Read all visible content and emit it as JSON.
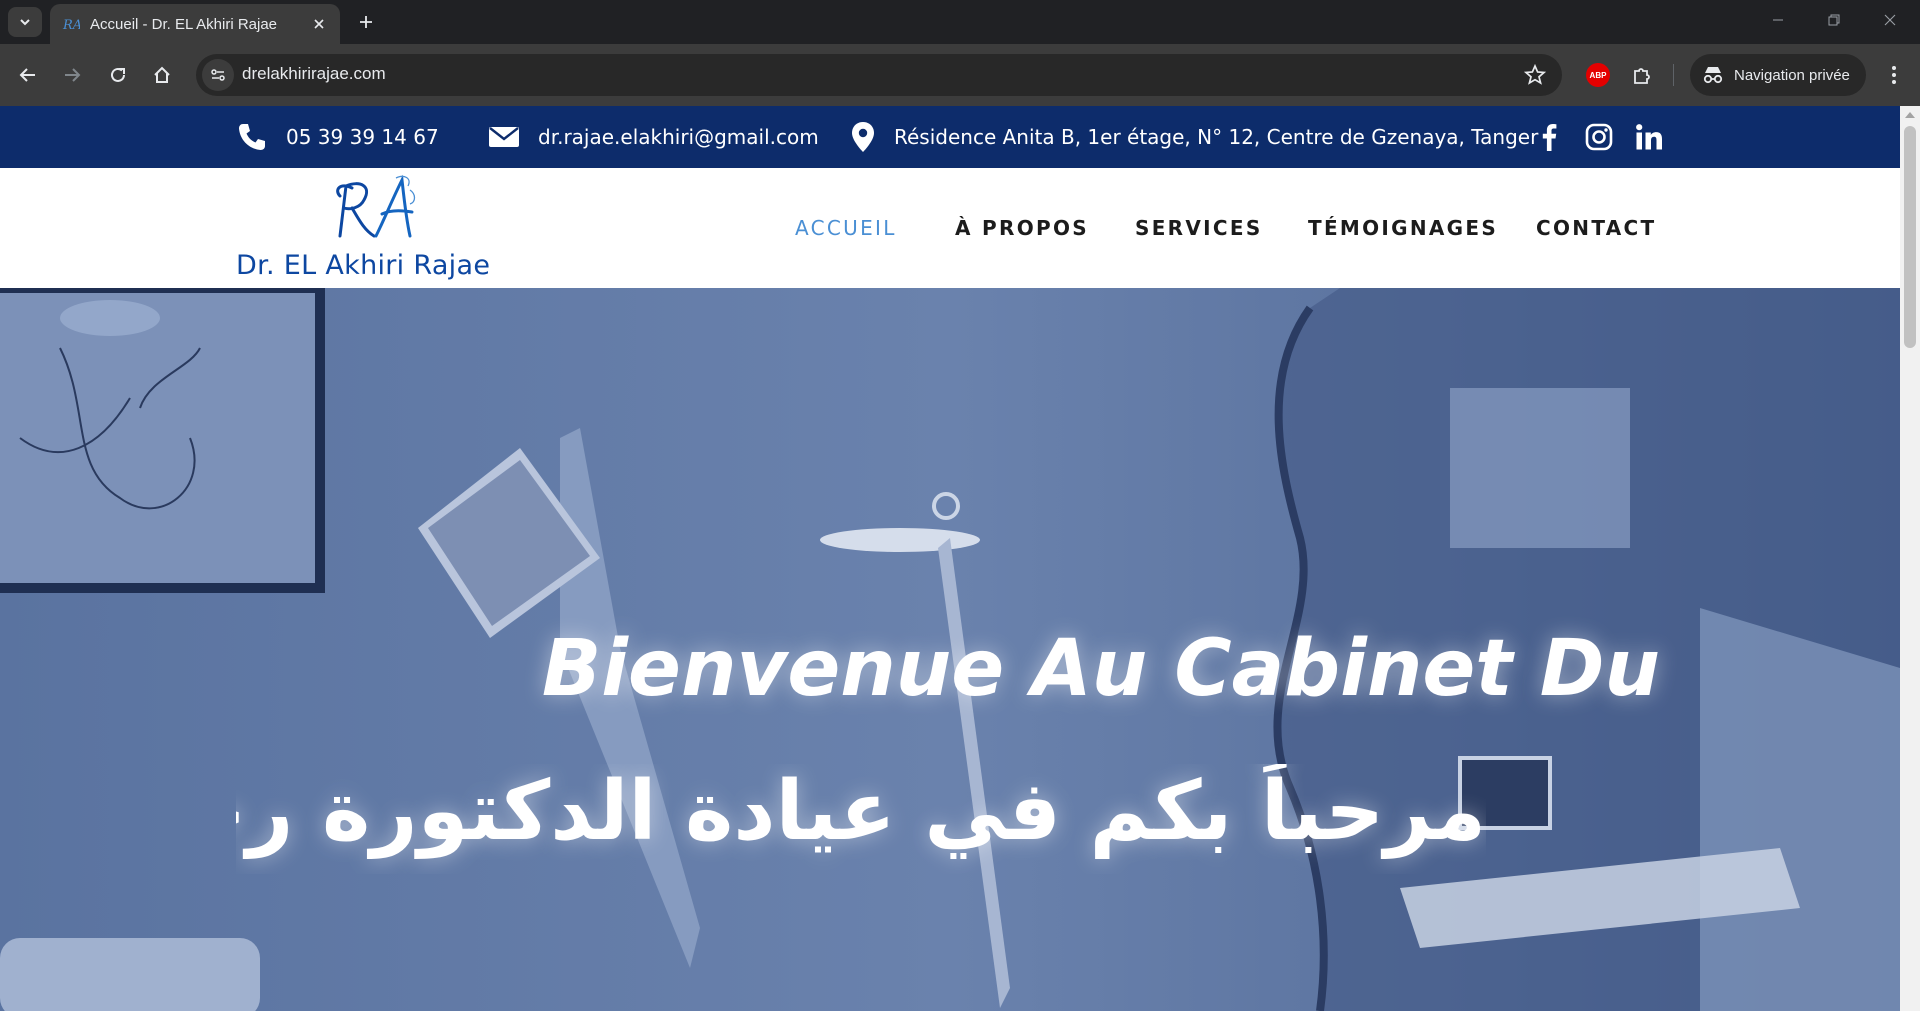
{
  "browser": {
    "tab_title": "Accueil - Dr. EL Akhiri Rajae",
    "url": "drelakhirirajae.com",
    "abp_label": "ABP",
    "incognito_label": "Navigation privée"
  },
  "topbar": {
    "phone": "05 39 39 14 67",
    "email": "dr.rajae.elakhiri@gmail.com",
    "address": "Résidence Anita B, 1er étage, N° 12, Centre de Gzenaya, Tanger"
  },
  "logo": {
    "monogram": "RA",
    "name": "Dr. EL Akhiri Rajae"
  },
  "nav": {
    "items": [
      "ACCUEIL",
      "À PROPOS",
      "SERVICES",
      "TÉMOIGNAGES",
      "CONTACT"
    ],
    "active": "ACCUEIL"
  },
  "hero": {
    "title_fr": "Bienvenue Au Cabinet Du",
    "title_ar": "مرحباً بكم في عيادة الدكتورة رجاء"
  },
  "colors": {
    "topbar_bg": "#0d2c6b",
    "brand_blue": "#0d47a1",
    "nav_active": "#4a8fd4",
    "hero_overlay": "#4a6391"
  }
}
